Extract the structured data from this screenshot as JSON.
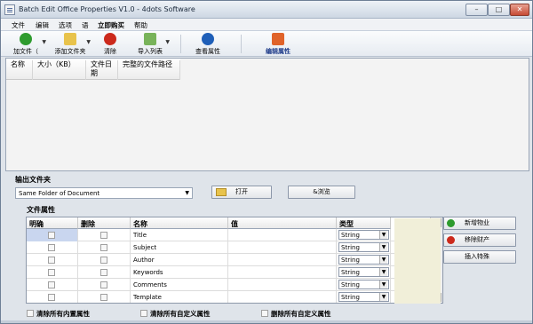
{
  "window": {
    "title": "Batch Edit Office Properties V1.0 - 4dots Software",
    "min": "–",
    "max": "□",
    "close": "✕"
  },
  "menu": [
    "文件",
    "编辑",
    "选项",
    "语",
    "立即购买",
    "帮助"
  ],
  "toolbar": {
    "add_file": "加文件（",
    "add_folder": "添加文件夹",
    "clear": "清除",
    "import_list": "导入列表",
    "view_props": "查看属性",
    "edit_props": "编辑属性"
  },
  "file_list": {
    "col_name": "名称",
    "col_size": "大小（KB）",
    "col_date": "文件日期",
    "col_path": "完整的文件路径"
  },
  "output": {
    "title": "输出文件夹",
    "selected": "Same Folder of Document",
    "open_label": "打开",
    "browse_label": "&浏览"
  },
  "props": {
    "title": "文件属性",
    "headers": {
      "clear": "明确",
      "delete": "删除",
      "name": "名称",
      "value": "值",
      "type": "类型"
    },
    "rows": [
      {
        "name": "Title",
        "type": "String"
      },
      {
        "name": "Subject",
        "type": "String"
      },
      {
        "name": "Author",
        "type": "String"
      },
      {
        "name": "Keywords",
        "type": "String"
      },
      {
        "name": "Comments",
        "type": "String"
      },
      {
        "name": "Template",
        "type": "String"
      }
    ],
    "side_buttons": {
      "new": "新增物业",
      "remove": "移除财产",
      "insert": "插入特殊"
    }
  },
  "footer": {
    "clear_builtin": "清除所有内置属性",
    "clear_custom": "清除所有自定义属性",
    "delete_custom": "删除所有自定义属性"
  },
  "colors": {
    "accent_green": "#2e9b2e",
    "accent_red": "#cc2a1c",
    "accent_blue": "#1f5fb8",
    "grid_blank": "#f1efd9"
  }
}
